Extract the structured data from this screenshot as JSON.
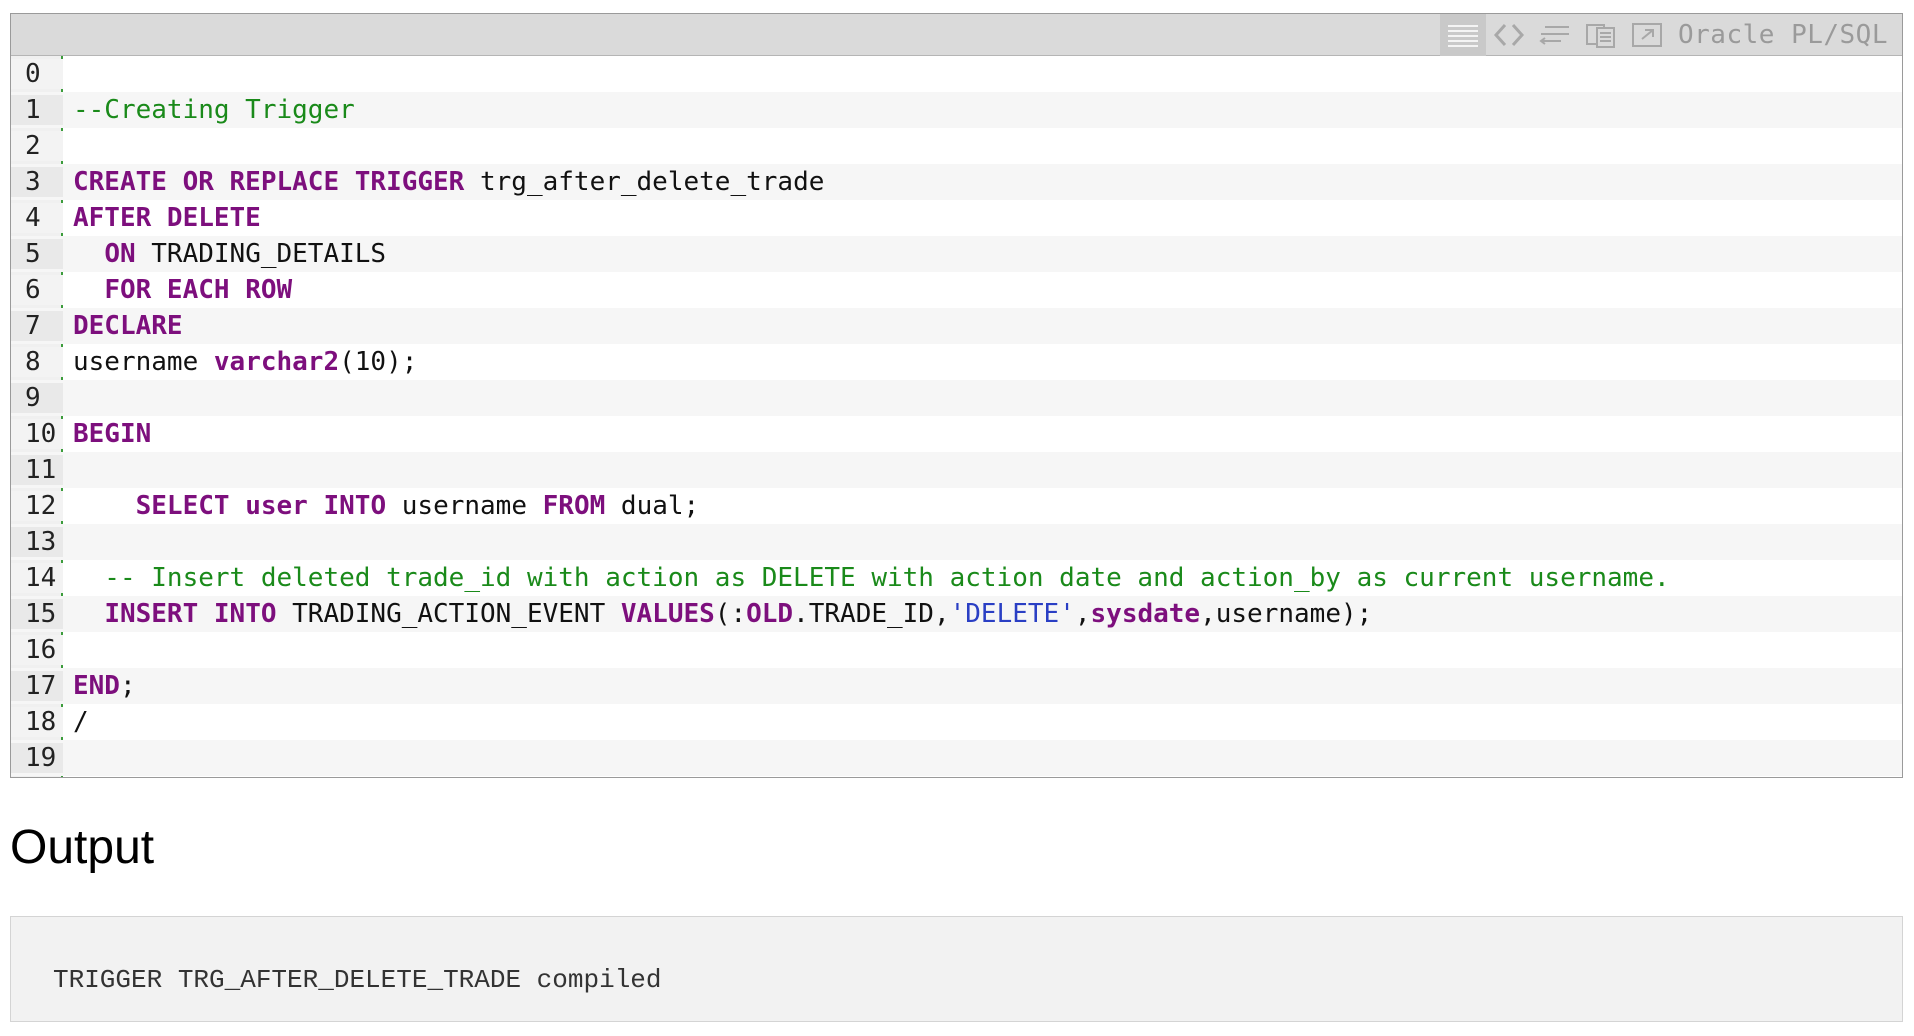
{
  "toolbar": {
    "icons": [
      "view-lines-icon",
      "code-icon",
      "wrap-icon",
      "copy-icon",
      "popout-icon"
    ],
    "language": "Oracle PL/SQL"
  },
  "code": {
    "lines": [
      {
        "n": "0",
        "tokens": []
      },
      {
        "n": "1",
        "tokens": [
          {
            "t": "--Creating Trigger",
            "c": "cm"
          }
        ]
      },
      {
        "n": "2",
        "tokens": []
      },
      {
        "n": "3",
        "tokens": [
          {
            "t": "CREATE OR REPLACE TRIGGER",
            "c": "kw"
          },
          {
            "t": " trg_after_delete_trade",
            "c": ""
          }
        ]
      },
      {
        "n": "4",
        "tokens": [
          {
            "t": "AFTER DELETE",
            "c": "kw"
          }
        ]
      },
      {
        "n": "5",
        "tokens": [
          {
            "t": "  ",
            "c": ""
          },
          {
            "t": "ON",
            "c": "kw"
          },
          {
            "t": " TRADING_DETAILS",
            "c": ""
          }
        ]
      },
      {
        "n": "6",
        "tokens": [
          {
            "t": "  ",
            "c": ""
          },
          {
            "t": "FOR EACH ROW",
            "c": "kw"
          }
        ]
      },
      {
        "n": "7",
        "tokens": [
          {
            "t": "DECLARE",
            "c": "kw"
          }
        ]
      },
      {
        "n": "8",
        "tokens": [
          {
            "t": "username ",
            "c": ""
          },
          {
            "t": "varchar2",
            "c": "kw"
          },
          {
            "t": "(10);",
            "c": ""
          }
        ]
      },
      {
        "n": "9",
        "tokens": []
      },
      {
        "n": "10",
        "tokens": [
          {
            "t": "BEGIN",
            "c": "kw"
          }
        ]
      },
      {
        "n": "11",
        "tokens": []
      },
      {
        "n": "12",
        "tokens": [
          {
            "t": "    ",
            "c": ""
          },
          {
            "t": "SELECT",
            "c": "kw"
          },
          {
            "t": " ",
            "c": ""
          },
          {
            "t": "user",
            "c": "kw"
          },
          {
            "t": " ",
            "c": ""
          },
          {
            "t": "INTO",
            "c": "kw"
          },
          {
            "t": " username ",
            "c": ""
          },
          {
            "t": "FROM",
            "c": "kw"
          },
          {
            "t": " dual;",
            "c": ""
          }
        ]
      },
      {
        "n": "13",
        "tokens": []
      },
      {
        "n": "14",
        "tokens": [
          {
            "t": "  -- Insert deleted trade_id with action as DELETE with action date and action_by as current username.",
            "c": "cm"
          }
        ]
      },
      {
        "n": "15",
        "tokens": [
          {
            "t": "  ",
            "c": ""
          },
          {
            "t": "INSERT INTO",
            "c": "kw"
          },
          {
            "t": " TRADING_ACTION_EVENT ",
            "c": ""
          },
          {
            "t": "VALUES",
            "c": "kw"
          },
          {
            "t": "(:",
            "c": ""
          },
          {
            "t": "OLD",
            "c": "kw"
          },
          {
            "t": ".TRADE_ID,",
            "c": ""
          },
          {
            "t": "'DELETE'",
            "c": "st"
          },
          {
            "t": ",",
            "c": ""
          },
          {
            "t": "sysdate",
            "c": "kw"
          },
          {
            "t": ",username);",
            "c": ""
          }
        ]
      },
      {
        "n": "16",
        "tokens": []
      },
      {
        "n": "17",
        "tokens": [
          {
            "t": "END",
            "c": "kw"
          },
          {
            "t": ";",
            "c": ""
          }
        ]
      },
      {
        "n": "18",
        "tokens": [
          {
            "t": "/",
            "c": ""
          }
        ]
      },
      {
        "n": "19",
        "tokens": []
      }
    ]
  },
  "output": {
    "heading": "Output",
    "text": "TRIGGER TRG_AFTER_DELETE_TRADE compiled"
  }
}
